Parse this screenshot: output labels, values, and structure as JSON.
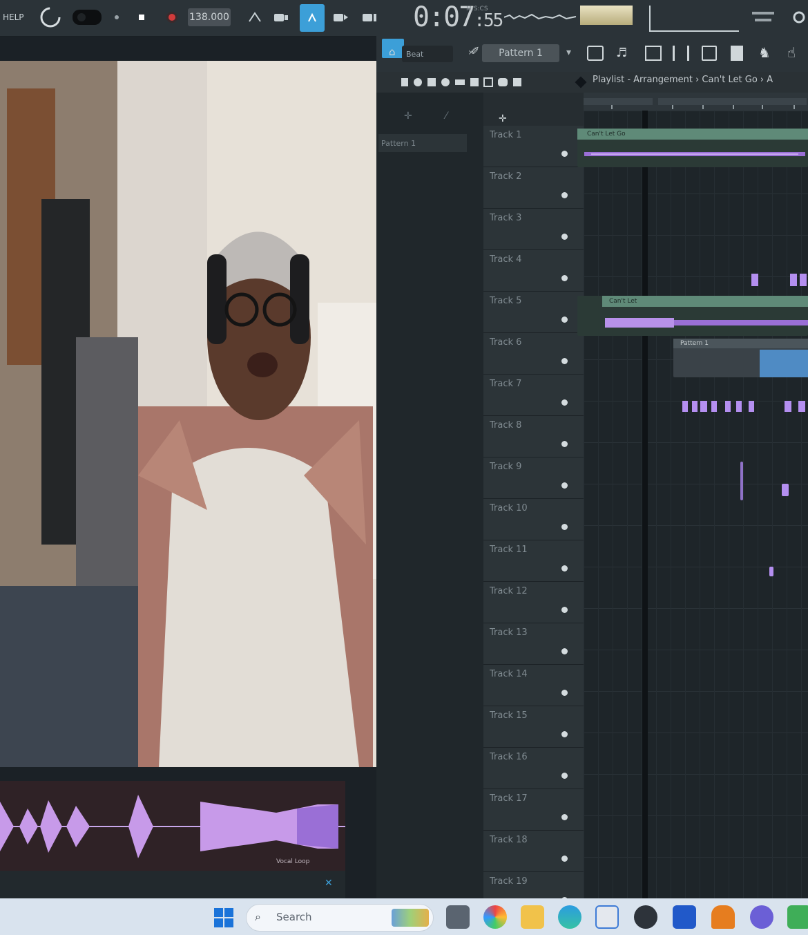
{
  "menu": {
    "help_label": "HELP"
  },
  "transport": {
    "tempo": "138.000",
    "time": "0:07",
    "time_fraction": ":55",
    "time_unit": "M:S:CS"
  },
  "toolbar2": {
    "preset_label": "Beat",
    "pattern_label": "Pattern 1"
  },
  "playlist": {
    "title": "Playlist - Arrangement › Can't Let Go › A",
    "picker_item": "Pattern 1",
    "tracks": [
      {
        "name": "Track 1"
      },
      {
        "name": "Track 2"
      },
      {
        "name": "Track 3"
      },
      {
        "name": "Track 4"
      },
      {
        "name": "Track 5"
      },
      {
        "name": "Track 6"
      },
      {
        "name": "Track 7"
      },
      {
        "name": "Track 8"
      },
      {
        "name": "Track 9"
      },
      {
        "name": "Track 10"
      },
      {
        "name": "Track 11"
      },
      {
        "name": "Track 12"
      },
      {
        "name": "Track 13"
      },
      {
        "name": "Track 14"
      },
      {
        "name": "Track 15"
      },
      {
        "name": "Track 16"
      },
      {
        "name": "Track 17"
      },
      {
        "name": "Track 18"
      },
      {
        "name": "Track 19"
      }
    ],
    "clips": {
      "track1_clip": "Can't Let Go",
      "track5_clip": "Can't Let",
      "track6_clip": "Pattern 1"
    }
  },
  "waveform": {
    "footer": "Vocal Loop"
  },
  "taskbar": {
    "search_placeholder": "Search"
  },
  "colors": {
    "audio_clip": "#9a6fd6",
    "pattern_clip": "#4f8bc4",
    "clip_header": "#5f8a78"
  }
}
